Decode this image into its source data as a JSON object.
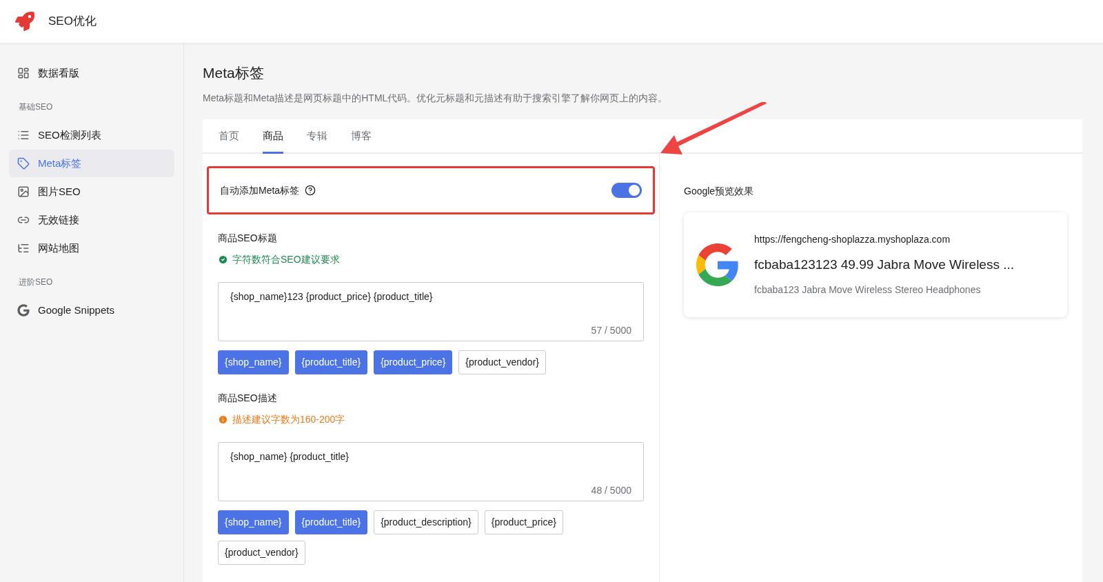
{
  "app": {
    "title": "SEO优化"
  },
  "sidebar": {
    "groups": [
      {
        "items": [
          {
            "kind": "dashboard",
            "label": "数据看版",
            "selected": false
          }
        ]
      },
      {
        "heading": "基础SEO",
        "items": [
          {
            "kind": "list",
            "label": "SEO检测列表",
            "selected": false
          },
          {
            "kind": "tag",
            "label": "Meta标签",
            "selected": true
          },
          {
            "kind": "image",
            "label": "图片SEO",
            "selected": false
          },
          {
            "kind": "link",
            "label": "无效链接",
            "selected": false
          },
          {
            "kind": "tree",
            "label": "网站地图",
            "selected": false
          }
        ]
      },
      {
        "heading": "进阶SEO",
        "items": [
          {
            "kind": "google",
            "label": "Google Snippets",
            "selected": false
          }
        ]
      }
    ]
  },
  "page": {
    "title": "Meta标签",
    "description": "Meta标题和Meta描述是网页标题中的HTML代码。优化元标题和元描述有助于搜索引擎了解你网页上的内容。"
  },
  "tabs": [
    {
      "label": "首页",
      "selected": false
    },
    {
      "label": "商品",
      "selected": true
    },
    {
      "label": "专辑",
      "selected": false
    },
    {
      "label": "博客",
      "selected": false
    }
  ],
  "auto_meta": {
    "label": "自动添加Meta标签",
    "on": true,
    "highlighted": true
  },
  "sections": [
    {
      "label": "商品SEO标题",
      "status": {
        "kind": "success",
        "text": "字符数符合SEO建议要求"
      },
      "value": "{shop_name}123 {product_price} {product_title}",
      "count": "57 / 5000",
      "variables": [
        {
          "label": "{shop_name}",
          "selected": true
        },
        {
          "label": "{product_title}",
          "selected": true
        },
        {
          "label": "{product_price}",
          "selected": true
        },
        {
          "label": "{product_vendor}",
          "selected": false
        }
      ]
    },
    {
      "label": "商品SEO描述",
      "status": {
        "kind": "warning",
        "text": "描述建议字数为160-200字"
      },
      "value": "{shop_name} {product_title}",
      "count": "48 / 5000",
      "variables": [
        {
          "label": "{shop_name}",
          "selected": true
        },
        {
          "label": "{product_title}",
          "selected": true
        },
        {
          "label": "{product_description}",
          "selected": false
        },
        {
          "label": "{product_price}",
          "selected": false
        },
        {
          "label": "{product_vendor}",
          "selected": false
        }
      ]
    }
  ],
  "preview": {
    "title": "Google预览效果",
    "url": "https://fengcheng-shoplazza.myshoplaza.com",
    "headline": "fcbaba123123 49.99 Jabra Move Wireless ...",
    "snippet": "fcbaba123 Jabra Move Wireless Stereo Headphones"
  }
}
